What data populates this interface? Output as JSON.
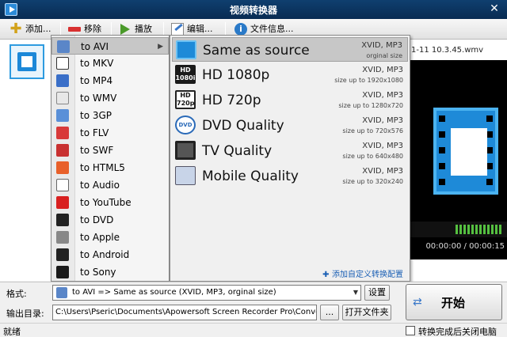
{
  "window": {
    "title": "视频转换器",
    "close_glyph": "✕"
  },
  "toolbar": {
    "add_label": "添加...",
    "remove_label": "移除",
    "play_label": "播放",
    "edit_label": "编辑...",
    "info_label": "文件信息..."
  },
  "file": {
    "name_partial": "1-11 10.3.45.wmv"
  },
  "preview": {
    "time": "00:00:00 / 00:00:15"
  },
  "categories": [
    {
      "label": "to AVI",
      "icon": "avi-icon",
      "selected": true
    },
    {
      "label": "to MKV",
      "icon": "mkv-icon"
    },
    {
      "label": "to MP4",
      "icon": "mp4-icon"
    },
    {
      "label": "to WMV",
      "icon": "wmv-icon"
    },
    {
      "label": "to 3GP",
      "icon": "3gp-icon"
    },
    {
      "label": "to FLV",
      "icon": "flv-icon"
    },
    {
      "label": "to SWF",
      "icon": "swf-icon"
    },
    {
      "label": "to HTML5",
      "icon": "html5-icon"
    },
    {
      "label": "to Audio",
      "icon": "audio-icon"
    },
    {
      "label": "to YouTube",
      "icon": "youtube-icon"
    },
    {
      "label": "to DVD",
      "icon": "dvd-icon"
    },
    {
      "label": "to Apple",
      "icon": "apple-icon"
    },
    {
      "label": "to Android",
      "icon": "android-icon"
    },
    {
      "label": "to Sony",
      "icon": "sony-icon"
    }
  ],
  "presets": [
    {
      "name": "Same as source",
      "codec": "XVID, MP3",
      "size": "orginal size",
      "icon": "film-icon",
      "selected": true
    },
    {
      "name": "HD 1080p",
      "codec": "XVID, MP3",
      "size": "size up to 1920x1080",
      "icon": "hd1080-icon"
    },
    {
      "name": "HD 720p",
      "codec": "XVID, MP3",
      "size": "size up to 1280x720",
      "icon": "hd720-icon"
    },
    {
      "name": "DVD Quality",
      "codec": "XVID, MP3",
      "size": "size up to 720x576",
      "icon": "dvd-quality-icon"
    },
    {
      "name": "TV Quality",
      "codec": "XVID, MP3",
      "size": "size up to 640x480",
      "icon": "tv-icon"
    },
    {
      "name": "Mobile Quality",
      "codec": "XVID, MP3",
      "size": "size up to 320x240",
      "icon": "mobile-icon"
    }
  ],
  "add_custom_label": "添加自定义转换配置",
  "badges": {
    "hd1080": "HD\n1080i",
    "hd720": "HD\n720p",
    "dvd": "DVD"
  },
  "format": {
    "label": "格式:",
    "value": "to AVI => Same as source (XVID, MP3, orginal size)",
    "settings_label": "设置"
  },
  "output": {
    "label": "输出目录:",
    "path": "C:\\Users\\Pseric\\Documents\\Apowersoft Screen Recorder Pro\\Convert\\",
    "browse_label": "...",
    "open_folder_label": "打开文件夹"
  },
  "start_label": "开始",
  "status": {
    "text": "就绪",
    "shutdown_label": "转换完成后关闭电脑",
    "shutdown_checked": false
  }
}
